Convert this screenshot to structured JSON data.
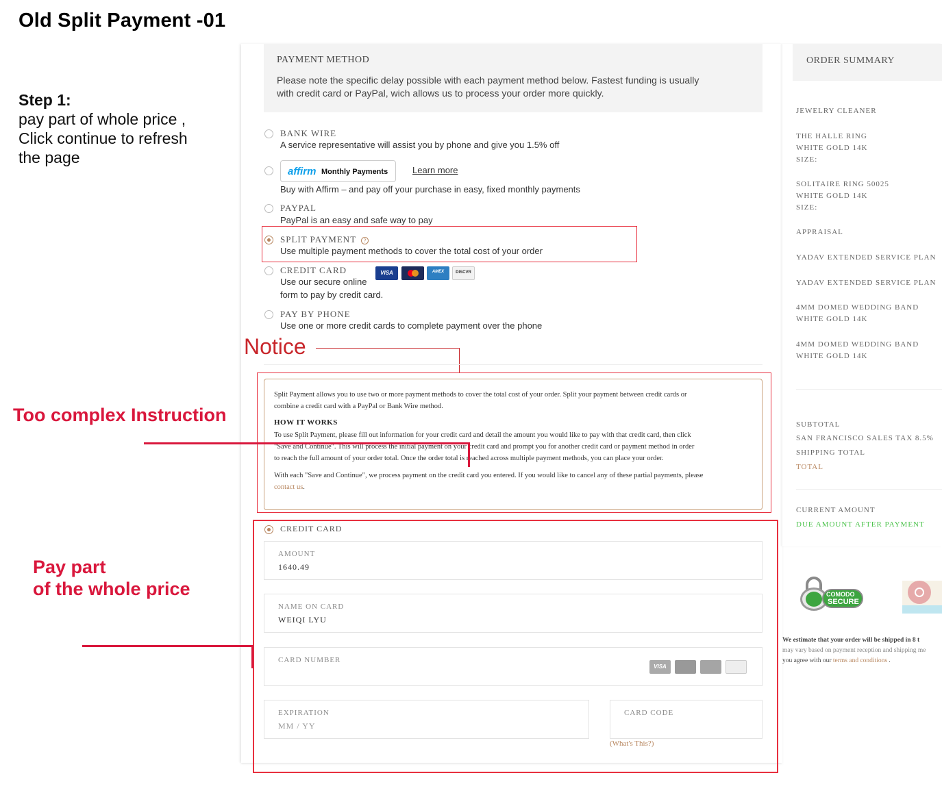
{
  "page_title": "Old Split Payment -01",
  "step": {
    "title": "Step 1:",
    "lines": [
      "pay part of whole price ,",
      "Click continue to refresh",
      "the page"
    ]
  },
  "annotations": {
    "notice": "Notice",
    "too_complex": "Too complex Instruction",
    "pay_part_line1": "Pay part",
    "pay_part_line2": "of the whole price",
    "accent_color": "#d9173c"
  },
  "payment_method": {
    "title": "PAYMENT METHOD",
    "desc_line1": "Please note the specific delay possible with each payment method below. Fastest funding is usually",
    "desc_line2": "with credit card or PayPal, wich allows us to process your order more quickly.",
    "bank_wire": {
      "title": "BANK WIRE",
      "desc": "A service representative will assist you by phone and give you 1.5% off"
    },
    "affirm": {
      "logo": "affirm",
      "label": "Monthly Payments",
      "learn_more": "Learn more",
      "desc": "Buy with Affirm – and pay off your purchase in easy, fixed monthly payments"
    },
    "paypal": {
      "title": "PAYPAL",
      "desc": "PayPal is an easy and safe way to pay"
    },
    "split": {
      "title": "SPLIT PAYMENT",
      "help": "?",
      "desc": "Use multiple payment methods to cover the total cost of your order"
    },
    "credit": {
      "title": "CREDIT CARD",
      "desc_line1": "Use our secure online",
      "desc_line2": "form to pay by credit card."
    },
    "phone": {
      "title": "PAY BY PHONE",
      "desc": "Use one or more credit cards to complete payment over the phone"
    },
    "card_logos": [
      "VISA",
      "MC",
      "AMEX",
      "DISCVR"
    ]
  },
  "notice_box": {
    "p1_line1": "Split Payment allows you to use two or more payment methods to cover the total cost of your order. Split your payment between credit cards or",
    "p1_line2": "combine a credit card with a PayPal or Bank Wire method.",
    "heading": "HOW IT WORKS",
    "p2_line1": "To use Split Payment, please fill out information for your credit card and detail the amount you would like to pay with that credit card, then click",
    "p2_line2": "\"Save and Continue\". This will process the initial payment on your credit card and prompt you for another credit card or payment method in order",
    "p2_line3": "to reach the full amount of your order total. Once the order total is reached across multiple payment methods, you can place your order.",
    "p3_line1": "With each \"Save and Continue\", we process payment on the credit card you entered. If you would like to cancel any of these partial payments, please",
    "p3_link": "contact us",
    "p3_end": "."
  },
  "card_form": {
    "title": "CREDIT CARD",
    "amount_label": "AMOUNT",
    "amount_value": "1640.49",
    "name_label": "NAME ON CARD",
    "name_value": "WEIQI LYU",
    "number_label": "CARD NUMBER",
    "expiration_label": "EXPIRATION",
    "expiration_placeholder": "MM / YY",
    "code_label": "CARD CODE",
    "whats_this": "(What's This?)"
  },
  "order_summary": {
    "title": "ORDER SUMMARY",
    "items": [
      [
        "JEWELRY CLEANER"
      ],
      [
        "THE HALLE RING",
        "WHITE GOLD 14K",
        "SIZE:"
      ],
      [
        "SOLITAIRE RING 50025",
        "WHITE GOLD 14K",
        "SIZE:"
      ],
      [
        "APPRAISAL"
      ],
      [
        "YADAV EXTENDED SERVICE PLAN"
      ],
      [
        "YADAV EXTENDED SERVICE PLAN"
      ],
      [
        "4MM DOMED WEDDING BAND",
        "WHITE GOLD 14K"
      ],
      [
        "4MM DOMED WEDDING BAND",
        "WHITE GOLD 14K"
      ]
    ],
    "subtotal": "SUBTOTAL",
    "tax": "SAN FRANCISCO SALES TAX 8.5%",
    "shipping": "SHIPPING TOTAL",
    "total": "TOTAL",
    "current_amount": "CURRENT AMOUNT",
    "due_amount": "DUE AMOUNT AFTER PAYMENT",
    "secure_badge_top": "COMODO",
    "secure_badge_bottom": "SECURE",
    "ship_line1": "We estimate that your order will be shipped in 8 t",
    "ship_line2": "may vary based on payment reception and shipping me",
    "ship_line3_a": "you agree with our",
    "ship_link": "terms and conditions",
    "ship_line3_b": "."
  }
}
